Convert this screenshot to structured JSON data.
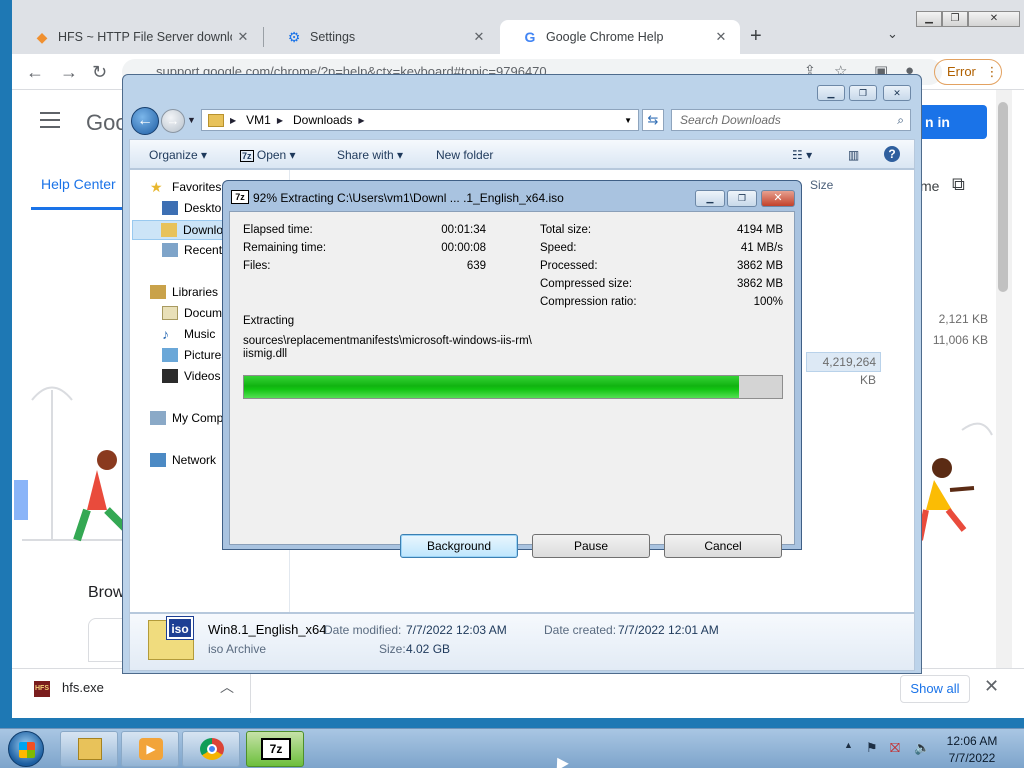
{
  "chrome": {
    "tabs": [
      {
        "title": "HFS ~ HTTP File Server downloa",
        "icon": "hfs-diamond-icon"
      },
      {
        "title": "Settings",
        "icon": "gear-icon"
      },
      {
        "title": "Google Chrome Help",
        "icon": "google-g-icon"
      }
    ],
    "close_glyph": "✕",
    "new_tab_glyph": "+",
    "url": "support.google.com/chrome/?p=help&ctx=keyboard#topic=9796470",
    "error_label": "Error",
    "page": {
      "logo_text": "Goo",
      "help_center": "Help Center",
      "sign_in": "n in",
      "me_text": "me",
      "browse_text": "Brow"
    },
    "download": {
      "filename": "hfs.exe",
      "icon_text": "HFS",
      "show_all": "Show all"
    }
  },
  "explorer": {
    "breadcrumb": [
      "VM1",
      "Downloads"
    ],
    "search_placeholder": "Search Downloads",
    "toolbar": {
      "organize": "Organize",
      "open": "Open",
      "share_with": "Share with",
      "new_folder": "New folder"
    },
    "nav": {
      "favorites": "Favorites",
      "desktop": "Desktop",
      "downloads": "Downlo",
      "recent": "Recent",
      "libraries": "Libraries",
      "documents": "Docum",
      "music": "Music",
      "pictures": "Pictures",
      "videos": "Videos",
      "computer": "My Comp",
      "network": "Network"
    },
    "column_size": "Size",
    "file_sizes": [
      "2,121 KB",
      "11,006 KB",
      "4,219,264 KB"
    ],
    "details": {
      "name": "Win8.1_English_x64",
      "type": "iso Archive",
      "icon_badge": "iso",
      "date_modified_label": "Date modified:",
      "date_modified": "7/7/2022 12:03 AM",
      "date_created_label": "Date created:",
      "date_created": "7/7/2022 12:01 AM",
      "size_label": "Size:",
      "size": "4.02 GB"
    }
  },
  "zip": {
    "logo": "7z",
    "title": "92% Extracting C:\\Users\\vm1\\Downl ... .1_English_x64.iso",
    "stats_left": [
      {
        "label": "Elapsed time:",
        "value": "00:01:34"
      },
      {
        "label": "Remaining time:",
        "value": "00:00:08"
      },
      {
        "label": "Files:",
        "value": "639"
      }
    ],
    "stats_right": [
      {
        "label": "Total size:",
        "value": "4194 MB"
      },
      {
        "label": "Speed:",
        "value": "41 MB/s"
      },
      {
        "label": "Processed:",
        "value": "3862 MB"
      },
      {
        "label": "Compressed size:",
        "value": "3862 MB"
      },
      {
        "label": "Compression ratio:",
        "value": "100%"
      }
    ],
    "action": "Extracting",
    "current_path_1": "sources\\replacementmanifests\\microsoft-windows-iis-rm\\",
    "current_path_2": "iismig.dll",
    "progress": 0.92,
    "buttons": {
      "background": "Background",
      "pause": "Pause",
      "cancel": "Cancel"
    }
  },
  "taskbar": {
    "time": "12:06 AM",
    "date": "7/7/2022",
    "apps": [
      "explorer",
      "media-player",
      "chrome",
      "7-zip"
    ],
    "zip_label": "7z"
  },
  "colors": {
    "accent": "#1a73e8",
    "progress_green": "#11b311",
    "taskbar": "#7da4cb"
  }
}
